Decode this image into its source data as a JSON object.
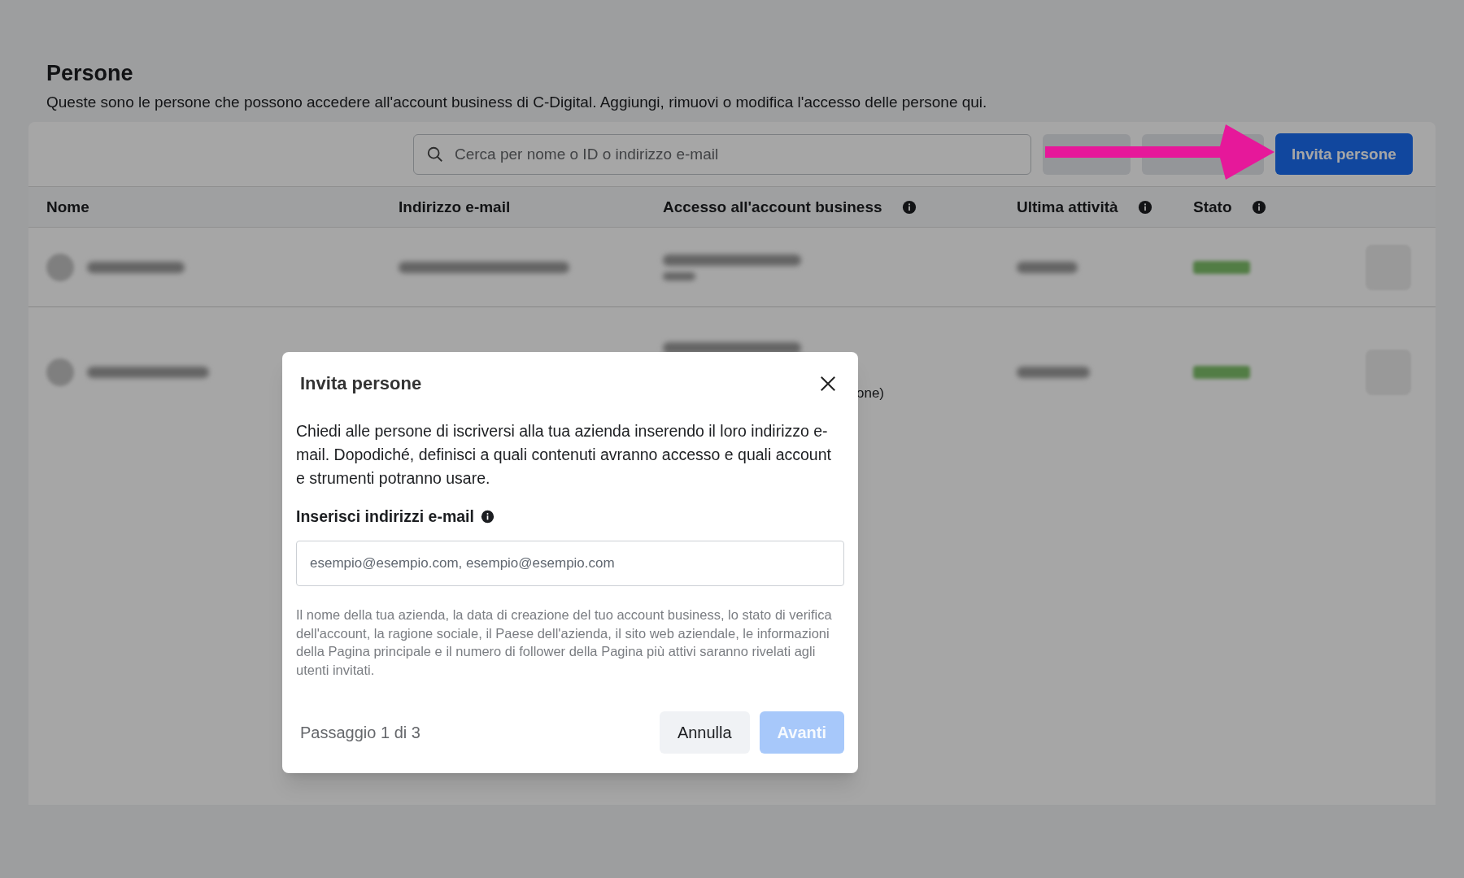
{
  "page": {
    "title": "Persone",
    "description": "Queste sono le persone che possono accedere all'account business di C-Digital. Aggiungi, rimuovi o modifica l'accesso delle persone qui."
  },
  "toolbar": {
    "search_placeholder": "Cerca per nome o ID o indirizzo e-mail",
    "invite_button": "Invita persone"
  },
  "table": {
    "columns": [
      {
        "label": "Nome",
        "info": false
      },
      {
        "label": "Indirizzo e-mail",
        "info": false
      },
      {
        "label": "Accesso all'account business",
        "info": true
      },
      {
        "label": "Ultima attività",
        "info": true
      },
      {
        "label": "Stato",
        "info": true
      }
    ],
    "rows": [
      {
        "kind": "blurred"
      },
      {
        "kind": "blurred",
        "access_fragment": "one)"
      }
    ]
  },
  "dialog": {
    "title": "Invita persone",
    "description": "Chiedi alle persone di iscriversi alla tua azienda inserendo il loro indirizzo e-mail. Dopodiché, definisci a quali contenuti avranno accesso e quali account e strumenti potranno usare.",
    "field_label": "Inserisci indirizzi e-mail",
    "field_placeholder": "esempio@esempio.com, esempio@esempio.com",
    "disclaimer": "Il nome della tua azienda, la data di creazione del tuo account business, lo stato di verifica dell'account, la ragione sociale, il Paese dell'azienda, il sito web aziendale, le informazioni della Pagina principale e il numero di follower della Pagina più attivi saranno rivelati agli utenti invitati.",
    "step": "Passaggio 1 di 3",
    "buttons": [
      {
        "label": "Annulla",
        "kind": "secondary",
        "disabled": false
      },
      {
        "label": "Avanti",
        "kind": "primary",
        "disabled": true
      }
    ]
  }
}
